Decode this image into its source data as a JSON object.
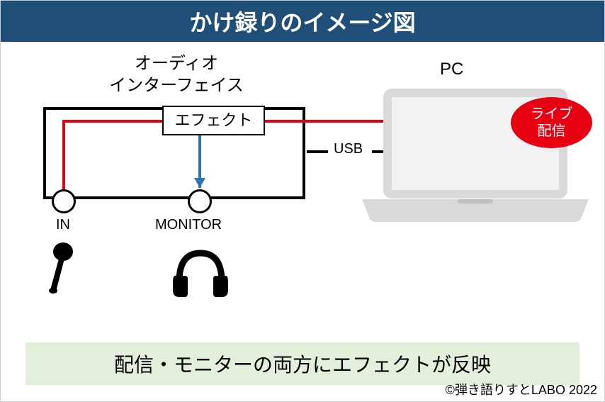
{
  "title": "かけ録りのイメージ図",
  "labels": {
    "interface_l1": "オーディオ",
    "interface_l2": "インターフェイス",
    "pc": "PC",
    "effect": "エフェクト",
    "in": "IN",
    "monitor": "MONITOR",
    "usb": "USB",
    "live_l1": "ライブ",
    "live_l2": "配信"
  },
  "subtitle": "配信・モニターの両方にエフェクトが反映",
  "credit": "©弾き語りすとLABO 2022",
  "colors": {
    "accent_red": "#e60012",
    "accent_blue": "#2e75b6",
    "title_bg": "#1f4e79",
    "subtitle_bg": "#e2efda"
  }
}
